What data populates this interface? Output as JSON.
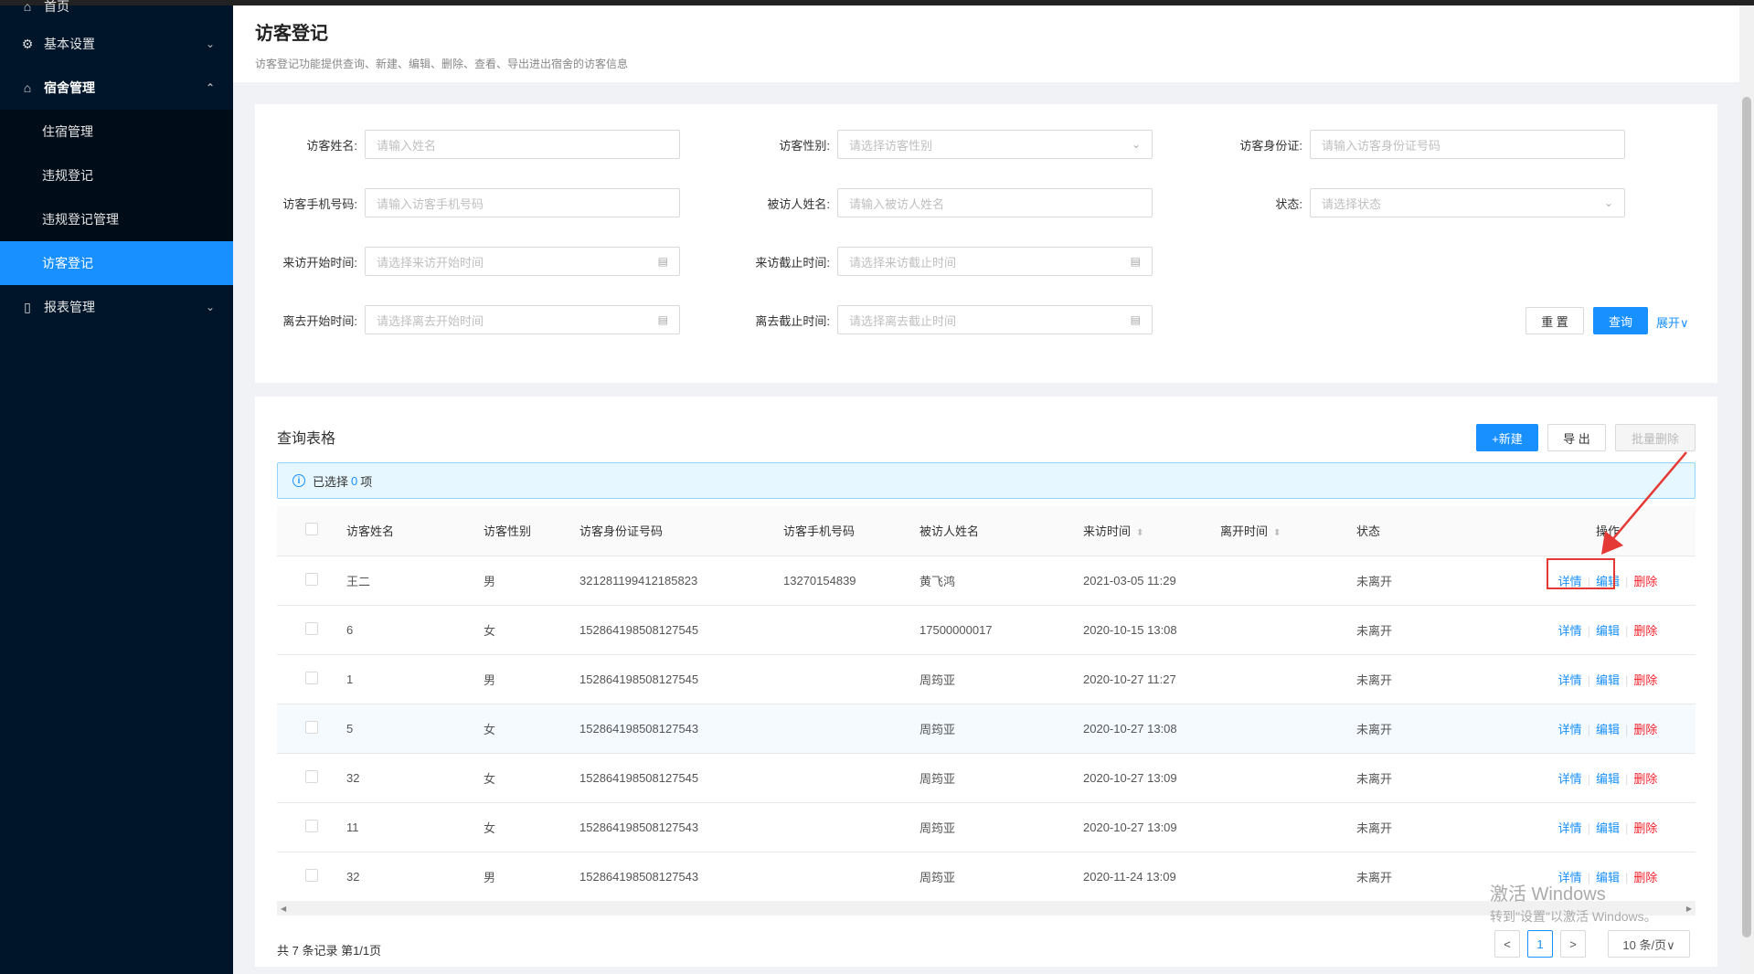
{
  "sidebar": {
    "home": "首页",
    "basic_settings": "基本设置",
    "dorm_mgmt": "宿舍管理",
    "sub_items": [
      "住宿管理",
      "违规登记",
      "违规登记管理",
      "访客登记"
    ],
    "report_mgmt": "报表管理"
  },
  "header": {
    "title": "访客登记",
    "desc": "访客登记功能提供查询、新建、编辑、删除、查看、导出进出宿舍的访客信息"
  },
  "search": {
    "visitor_name_label": "访客姓名:",
    "visitor_name_ph": "请输入姓名",
    "gender_label": "访客性别:",
    "gender_ph": "请选择访客性别",
    "id_label": "访客身份证:",
    "id_ph": "请输入访客身份证号码",
    "phone_label": "访客手机号码:",
    "phone_ph": "请输入访客手机号码",
    "host_label": "被访人姓名:",
    "host_ph": "请输入被访人姓名",
    "status_label": "状态:",
    "status_ph": "请选择状态",
    "visit_start_label": "来访开始时间:",
    "visit_start_ph": "请选择来访开始时间",
    "visit_end_label": "来访截止时间:",
    "visit_end_ph": "请选择来访截止时间",
    "leave_start_label": "离去开始时间:",
    "leave_start_ph": "请选择离去开始时间",
    "leave_end_label": "离去截止时间:",
    "leave_end_ph": "请选择离去截止时间",
    "reset": "重 置",
    "query": "查询",
    "expand": "展开∨"
  },
  "table": {
    "title": "查询表格",
    "new_btn": "+新建",
    "export_btn": "导 出",
    "batch_delete_btn": "批量删除",
    "alert_prefix": "已选择",
    "alert_count": "0",
    "alert_suffix": "项",
    "columns": [
      "访客姓名",
      "访客性别",
      "访客身份证号码",
      "访客手机号码",
      "被访人姓名",
      "来访时间",
      "离开时间",
      "状态",
      "操作"
    ],
    "rows": [
      {
        "name": "王二",
        "gender": "男",
        "id": "321281199412185823",
        "phone": "13270154839",
        "host": "黄飞鸿",
        "visit": "2021-03-05 11:29",
        "leave": "",
        "status": "未离开"
      },
      {
        "name": "6",
        "gender": "女",
        "id": "152864198508127545",
        "phone": "",
        "host": "17500000017",
        "visit": "2020-10-15 13:08",
        "leave": "",
        "status": "未离开"
      },
      {
        "name": "1",
        "gender": "男",
        "id": "152864198508127545",
        "phone": "",
        "host": "周筠亚",
        "visit": "2020-10-27 11:27",
        "leave": "",
        "status": "未离开"
      },
      {
        "name": "5",
        "gender": "女",
        "id": "152864198508127543",
        "phone": "",
        "host": "周筠亚",
        "visit": "2020-10-27 13:08",
        "leave": "",
        "status": "未离开"
      },
      {
        "name": "32",
        "gender": "女",
        "id": "152864198508127545",
        "phone": "",
        "host": "周筠亚",
        "visit": "2020-10-27 13:09",
        "leave": "",
        "status": "未离开"
      },
      {
        "name": "11",
        "gender": "女",
        "id": "152864198508127543",
        "phone": "",
        "host": "周筠亚",
        "visit": "2020-10-27 13:09",
        "leave": "",
        "status": "未离开"
      },
      {
        "name": "32",
        "gender": "男",
        "id": "152864198508127543",
        "phone": "",
        "host": "周筠亚",
        "visit": "2020-11-24 13:09",
        "leave": "",
        "status": "未离开"
      }
    ],
    "op_detail": "详情",
    "op_edit": "编辑",
    "op_delete": "删除"
  },
  "footer": {
    "total": "共 7 条记录 第1/1页",
    "prev": "<",
    "page": "1",
    "next": ">",
    "page_size": "10 条/页∨"
  },
  "watermark": {
    "line1": "激活 Windows",
    "line2": "转到\"设置\"以激活 Windows。"
  },
  "colors": {
    "sidebar_bg": "#001529",
    "primary": "#1890ff",
    "danger": "#f5222d",
    "annotation": "#e53935"
  }
}
